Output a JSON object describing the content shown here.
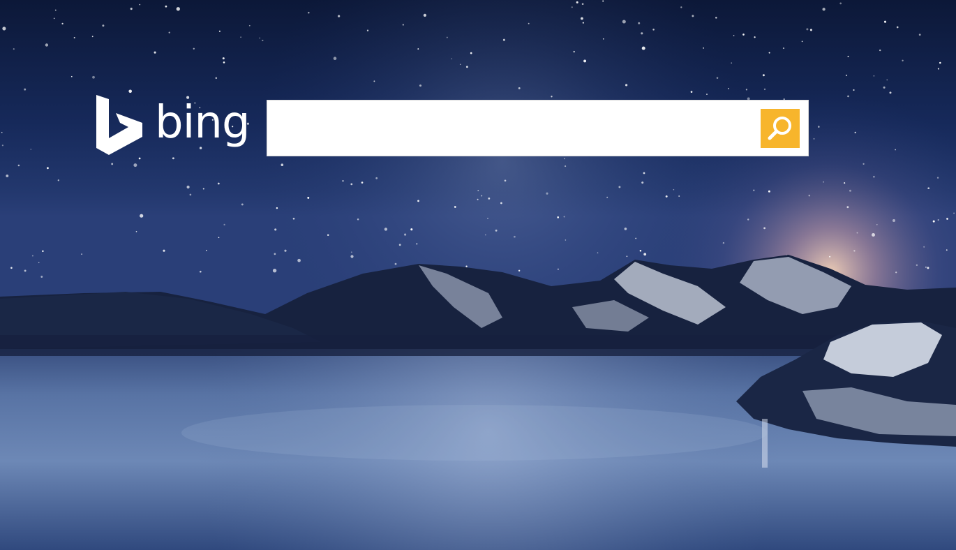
{
  "brand": {
    "name": "bing",
    "logo_icon": "bing-logo-icon"
  },
  "search": {
    "value": "",
    "placeholder": "",
    "button_icon": "search-icon",
    "button_color": "#f7b52c"
  },
  "background": {
    "description_icon": "starry-night-lake-image",
    "sky_color": "#0f2350",
    "water_color": "#4a6898"
  }
}
